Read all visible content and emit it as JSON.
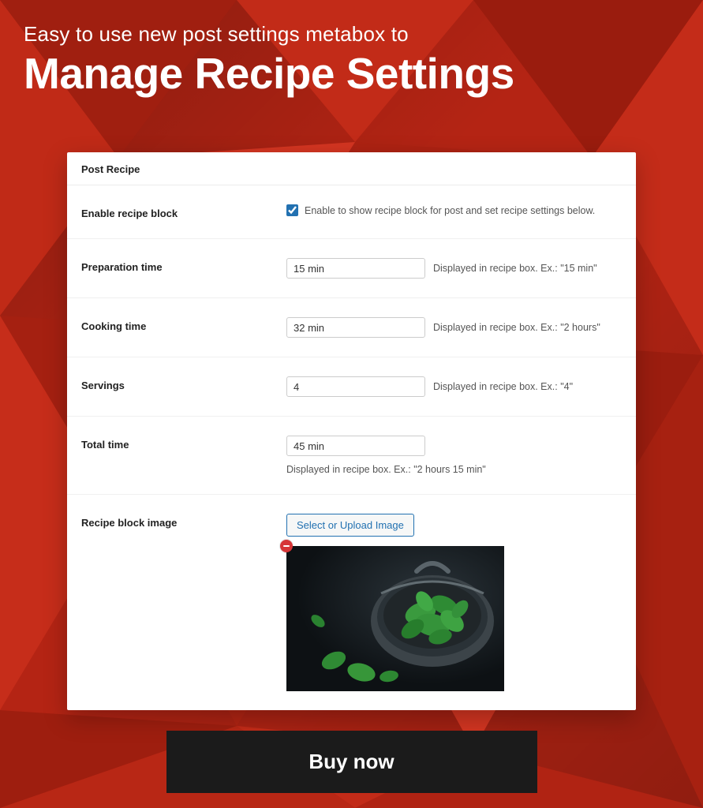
{
  "hero": {
    "subtitle": "Easy to use new post settings metabox to",
    "title": "Manage Recipe Settings"
  },
  "panel": {
    "header": "Post Recipe",
    "enable": {
      "label": "Enable recipe block",
      "checked": true,
      "hint": "Enable to show recipe block for post and set recipe settings below."
    },
    "prep": {
      "label": "Preparation time",
      "value": "15 min",
      "hint": "Displayed in recipe box. Ex.: \"15 min\""
    },
    "cook": {
      "label": "Cooking time",
      "value": "32 min",
      "hint": "Displayed in recipe box. Ex.: \"2 hours\""
    },
    "servings": {
      "label": "Servings",
      "value": "4",
      "hint": "Displayed in recipe box. Ex.: \"4\""
    },
    "total": {
      "label": "Total time",
      "value": "45 min",
      "hint": "Displayed in recipe box. Ex.: \"2 hours 15 min\""
    },
    "image": {
      "label": "Recipe block image",
      "button": "Select or Upload Image"
    }
  },
  "cta": {
    "label": "Buy now"
  }
}
